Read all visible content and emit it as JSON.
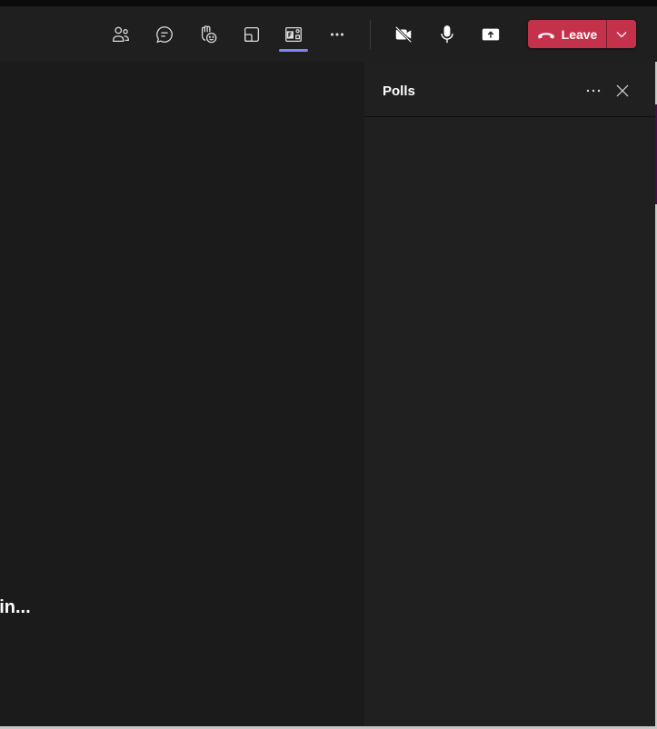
{
  "toolbar": {
    "buttons": [
      {
        "name": "people",
        "icon": "people-icon"
      },
      {
        "name": "chat",
        "icon": "chat-icon"
      },
      {
        "name": "react",
        "icon": "raise-hand-react-icon"
      },
      {
        "name": "rooms",
        "icon": "breakout-rooms-icon"
      },
      {
        "name": "apps",
        "icon": "forms-apps-icon",
        "active": true
      },
      {
        "name": "more",
        "icon": "more-icon"
      },
      {
        "name": "camera",
        "icon": "camera-off-icon"
      },
      {
        "name": "mic",
        "icon": "mic-icon"
      },
      {
        "name": "share",
        "icon": "share-icon"
      }
    ],
    "leave_label": "Leave",
    "accent": "#7f85f5",
    "leave_color": "#c4314b"
  },
  "stage": {
    "status_text": "oin..."
  },
  "panel": {
    "title": "Polls"
  }
}
